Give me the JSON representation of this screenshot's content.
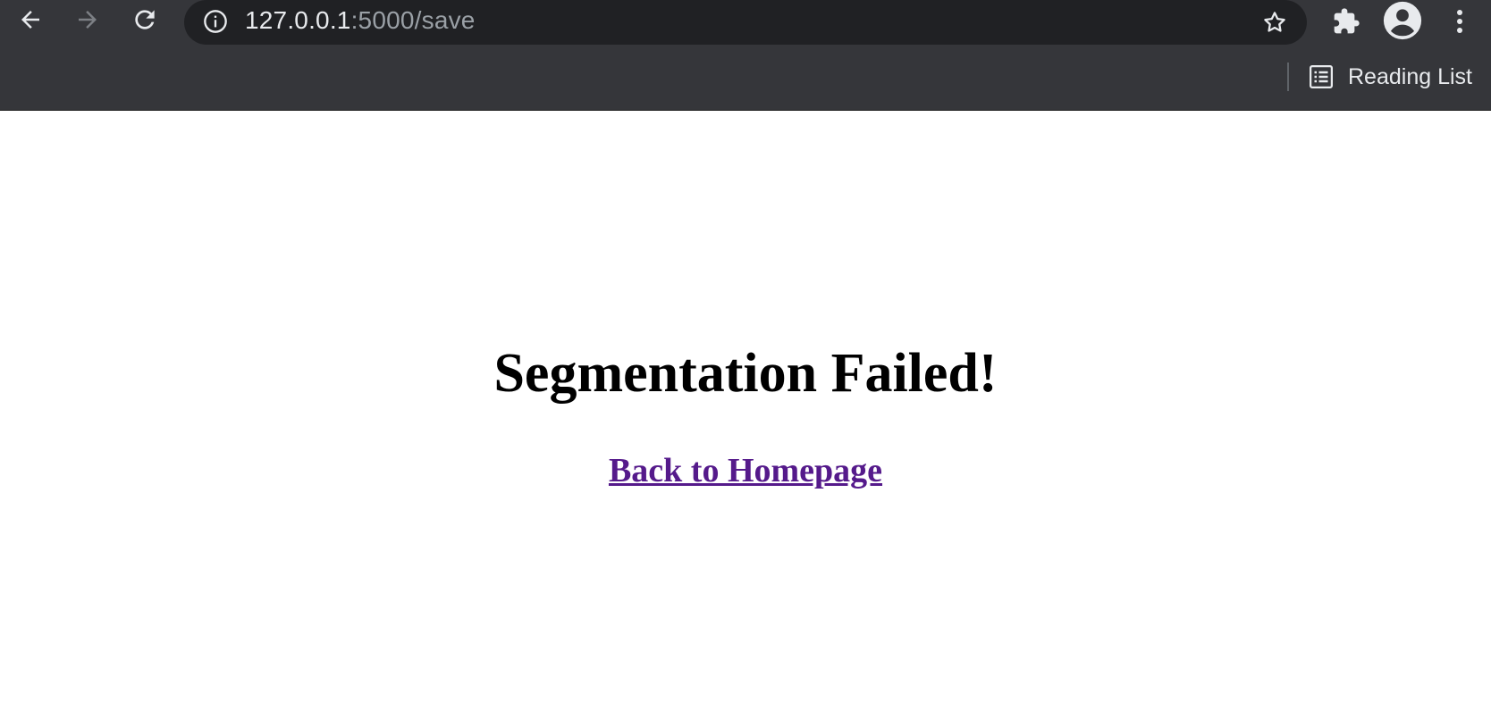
{
  "browser": {
    "url_host": "127.0.0.1",
    "url_rest": ":5000/save",
    "bookmarks_bar": {
      "reading_list_label": "Reading List"
    },
    "icons": {
      "back": "back-arrow-icon",
      "forward": "forward-arrow-icon",
      "reload": "reload-icon",
      "site_info": "info-icon",
      "bookmark_star": "star-icon",
      "extensions": "puzzle-icon",
      "profile": "account-icon",
      "menu": "kebab-menu-icon",
      "reading_list": "reading-list-icon"
    }
  },
  "page": {
    "heading": "Segmentation Failed!",
    "link_label": "Back to Homepage"
  },
  "colors": {
    "chrome_bg": "#35363a",
    "omnibox_bg": "#202124",
    "visited_link": "#551a8b",
    "text_light": "#e8eaed",
    "text_muted": "#9aa0a6"
  }
}
